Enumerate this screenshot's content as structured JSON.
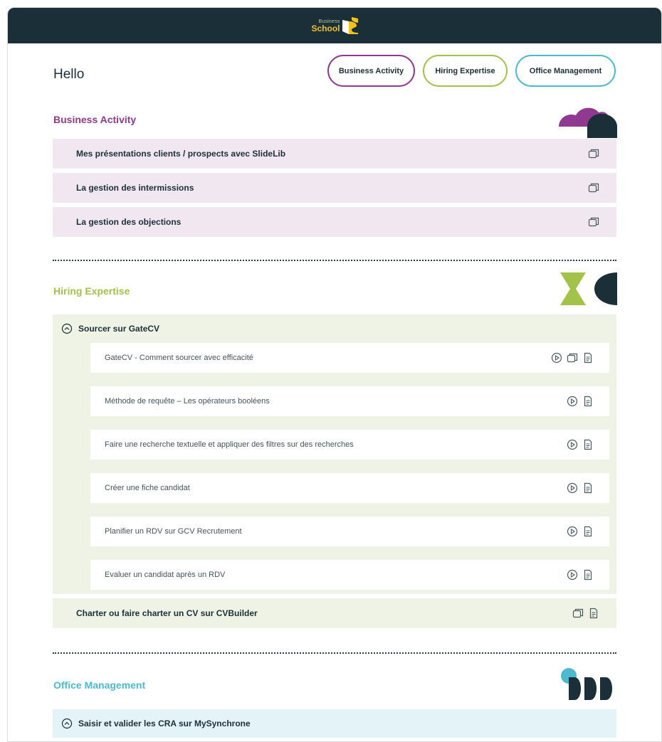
{
  "header": {
    "logo_small": "Business",
    "logo_big": "School"
  },
  "greeting": "Hello",
  "nav": {
    "business_activity": "Business Activity",
    "hiring_expertise": "Hiring Expertise",
    "office_management": "Office Management"
  },
  "colors": {
    "topbar": "#1b2f38",
    "business_activity": "#8f3a90",
    "hiring_expertise": "#a3c24a",
    "office_management": "#4cb9cf"
  },
  "business_activity": {
    "title": "Business Activity",
    "items": [
      {
        "label": "Mes présentations clients / prospects avec SlideLib",
        "icons": [
          "slides-icon"
        ]
      },
      {
        "label": "La gestion des intermissions",
        "icons": [
          "slides-icon"
        ]
      },
      {
        "label": "La gestion des objections",
        "icons": [
          "slides-icon"
        ]
      }
    ]
  },
  "hiring_expertise": {
    "title": "Hiring Expertise",
    "group": {
      "label": "Sourcer sur GateCV",
      "expanded": true,
      "items": [
        {
          "label": "GateCV - Comment sourcer avec efficacité",
          "icons": [
            "play-icon",
            "slides-icon",
            "document-icon"
          ]
        },
        {
          "label": "Méthode de requête – Les opérateurs booléens",
          "icons": [
            "play-icon",
            "document-icon"
          ]
        },
        {
          "label": "Faire une recherche textuelle et appliquer des filtres sur des recherches",
          "icons": [
            "play-icon",
            "document-icon"
          ]
        },
        {
          "label": "Créer une fiche candidat",
          "icons": [
            "play-icon",
            "document-icon"
          ]
        },
        {
          "label": "Planifier un RDV sur GCV Recrutement",
          "icons": [
            "play-icon",
            "document-icon"
          ]
        },
        {
          "label": "Evaluer un candidat après un RDV",
          "icons": [
            "play-icon",
            "document-icon"
          ]
        }
      ]
    },
    "extra_item": {
      "label": "Charter ou faire charter un CV sur CVBuilder",
      "icons": [
        "slides-icon",
        "document-icon"
      ]
    }
  },
  "office_management": {
    "title": "Office Management",
    "group": {
      "label": "Saisir et valider les CRA sur MySynchrone",
      "expanded": true
    }
  }
}
